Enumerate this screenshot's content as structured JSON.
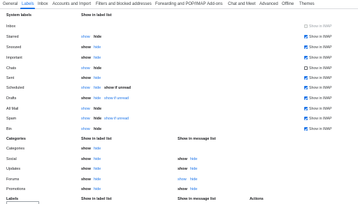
{
  "tabs": [
    "General",
    "Labels",
    "Inbox",
    "Accounts and Import",
    "Filters and blocked addresses",
    "Forwarding and POP/IMAP",
    "Add-ons",
    "Chat and Meet",
    "Advanced",
    "Offline",
    "Themes"
  ],
  "active_tab": "Labels",
  "system": {
    "header": "System labels",
    "col_list": "Show in label list",
    "rows": [
      {
        "name": "Inbox",
        "show": "",
        "hide": "",
        "unread": "",
        "imap": "Show in IMAP"
      },
      {
        "name": "Starred",
        "show": "show",
        "hide": "hide",
        "unread": "",
        "imap": "Show in IMAP"
      },
      {
        "name": "Snoozed",
        "show": "show",
        "hide": "hide",
        "unread": "",
        "imap": "Show in IMAP"
      },
      {
        "name": "Important",
        "show": "show",
        "hide": "hide",
        "unread": "",
        "imap": "Show in IMAP"
      },
      {
        "name": "Chats",
        "show": "show",
        "hide": "hide",
        "unread": "",
        "imap": "Show in IMAP"
      },
      {
        "name": "Sent",
        "show": "show",
        "hide": "hide",
        "unread": "",
        "imap": "Show in IMAP"
      },
      {
        "name": "Scheduled",
        "show": "show",
        "hide": "hide",
        "unread": "show if unread",
        "imap": "Show in IMAP"
      },
      {
        "name": "Drafts",
        "show": "show",
        "hide": "hide",
        "unread": "show if unread",
        "imap": "Show in IMAP"
      },
      {
        "name": "All Mail",
        "show": "show",
        "hide": "hide",
        "unread": "",
        "imap": "Show in IMAP"
      },
      {
        "name": "Spam",
        "show": "show",
        "hide": "hide",
        "unread": "show if unread",
        "imap": "Show in IMAP"
      },
      {
        "name": "Bin",
        "show": "show",
        "hide": "hide",
        "unread": "",
        "imap": "Show in IMAP"
      }
    ]
  },
  "categories": {
    "header": "Categories",
    "col_list": "Show in label list",
    "col_msg": "Show in message list",
    "rows": [
      {
        "name": "Categories",
        "show": "show",
        "hide": "hide",
        "mshow": "",
        "mhide": ""
      },
      {
        "name": "Social",
        "show": "show",
        "hide": "hide",
        "mshow": "show",
        "mhide": "hide"
      },
      {
        "name": "Updates",
        "show": "show",
        "hide": "hide",
        "mshow": "show",
        "mhide": "hide"
      },
      {
        "name": "Forums",
        "show": "show",
        "hide": "hide",
        "mshow": "show",
        "mhide": "hide"
      },
      {
        "name": "Promotions",
        "show": "show",
        "hide": "hide",
        "mshow": "show",
        "mhide": "hide"
      }
    ]
  },
  "labels": {
    "header": "Labels",
    "col_list": "Show in label list",
    "col_msg": "Show in message list",
    "col_actions": "Actions"
  }
}
